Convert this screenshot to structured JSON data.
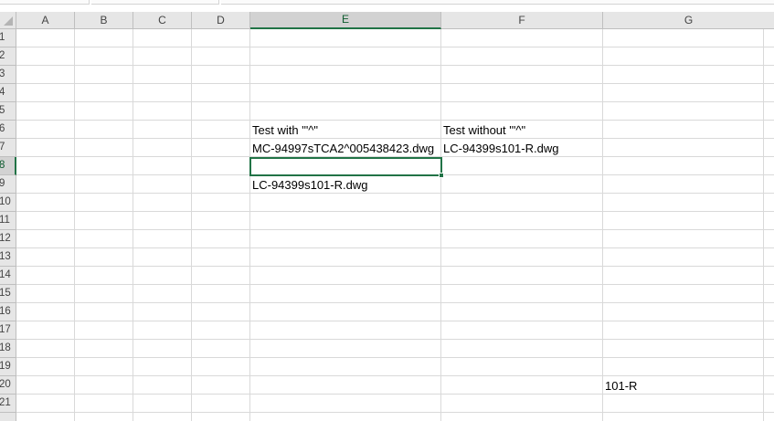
{
  "columns": [
    "A",
    "B",
    "C",
    "D",
    "E",
    "F",
    "G"
  ],
  "rows": [
    "1",
    "2",
    "3",
    "4",
    "5",
    "6",
    "7",
    "8",
    "9",
    "10",
    "11",
    "12",
    "13",
    "14",
    "15",
    "16",
    "17",
    "18",
    "19",
    "20",
    "21"
  ],
  "cells": {
    "E6": "Test with '\"^\"",
    "F6": "Test without '\"^\"",
    "E7": "MC-94997sTCA2^005438423.dwg",
    "F7": "LC-94399s101-R.dwg",
    "E9": "LC-94399s101-R.dwg",
    "G20": "101-R"
  },
  "selected_cell": "E8",
  "colors": {
    "selection": "#217346",
    "header_bg": "#e6e6e6",
    "gridline": "#d9d9d9"
  }
}
